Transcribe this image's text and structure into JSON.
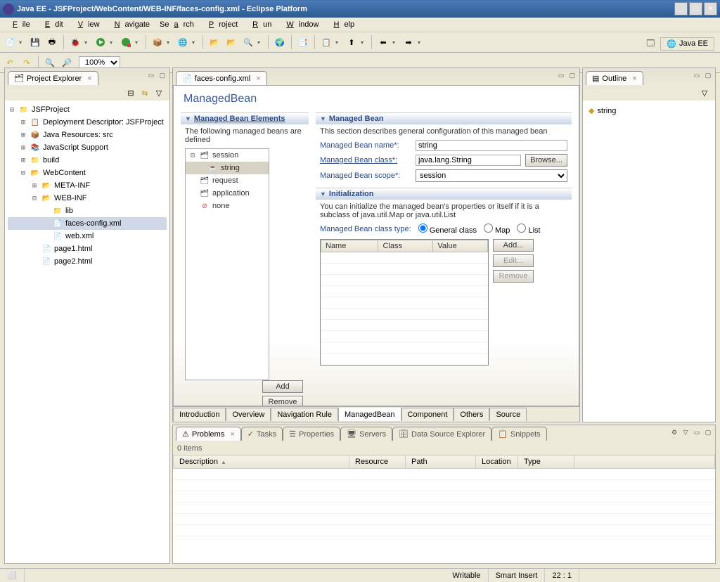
{
  "window": {
    "title": "Java EE - JSFProject/WebContent/WEB-INF/faces-config.xml - Eclipse Platform"
  },
  "menu": [
    "File",
    "Edit",
    "View",
    "Navigate",
    "Search",
    "Project",
    "Run",
    "Window",
    "Help"
  ],
  "zoom": "100%",
  "perspective": "Java EE",
  "project_explorer": {
    "title": "Project Explorer",
    "root": "JSFProject",
    "items": {
      "dd": "Deployment Descriptor: JSFProject",
      "jr": "Java Resources: src",
      "js": "JavaScript Support",
      "build": "build",
      "wc": "WebContent",
      "meta": "META-INF",
      "webinf": "WEB-INF",
      "lib": "lib",
      "faces": "faces-config.xml",
      "webxml": "web.xml",
      "p1": "page1.html",
      "p2": "page2.html"
    }
  },
  "editor": {
    "tab": "faces-config.xml",
    "title": "ManagedBean",
    "elements": {
      "heading": "Managed Bean Elements",
      "desc": "The following managed beans are defined",
      "tree": {
        "session": "session",
        "string": "string",
        "request": "request",
        "application": "application",
        "none": "none"
      },
      "add": "Add",
      "remove": "Remove"
    },
    "mb": {
      "heading": "Managed Bean",
      "desc": "This section describes general configuration of this managed bean",
      "name_lbl": "Managed Bean name*:",
      "name_val": "string",
      "class_lbl": "Managed Bean class*:",
      "class_val": "java.lang.String",
      "browse": "Browse...",
      "scope_lbl": "Managed Bean scope*:",
      "scope_val": "session"
    },
    "init": {
      "heading": "Initialization",
      "desc": "You can initialize the managed bean's properties or itself if it is a subclass of java.util.Map or java.util.List",
      "type_lbl": "Managed Bean class type:",
      "general": "General class",
      "map": "Map",
      "list": "List",
      "cols": {
        "name": "Name",
        "class": "Class",
        "value": "Value"
      },
      "add": "Add...",
      "edit": "Edit...",
      "remove": "Remove"
    },
    "bottom_tabs": [
      "Introduction",
      "Overview",
      "Navigation Rule",
      "ManagedBean",
      "Component",
      "Others",
      "Source"
    ]
  },
  "outline": {
    "title": "Outline",
    "item": "string"
  },
  "problems": {
    "tabs": [
      "Problems",
      "Tasks",
      "Properties",
      "Servers",
      "Data Source Explorer",
      "Snippets"
    ],
    "items": "0 items",
    "cols": [
      "Description",
      "Resource",
      "Path",
      "Location",
      "Type"
    ]
  },
  "status": {
    "writable": "Writable",
    "insert": "Smart Insert",
    "pos": "22 : 1"
  }
}
